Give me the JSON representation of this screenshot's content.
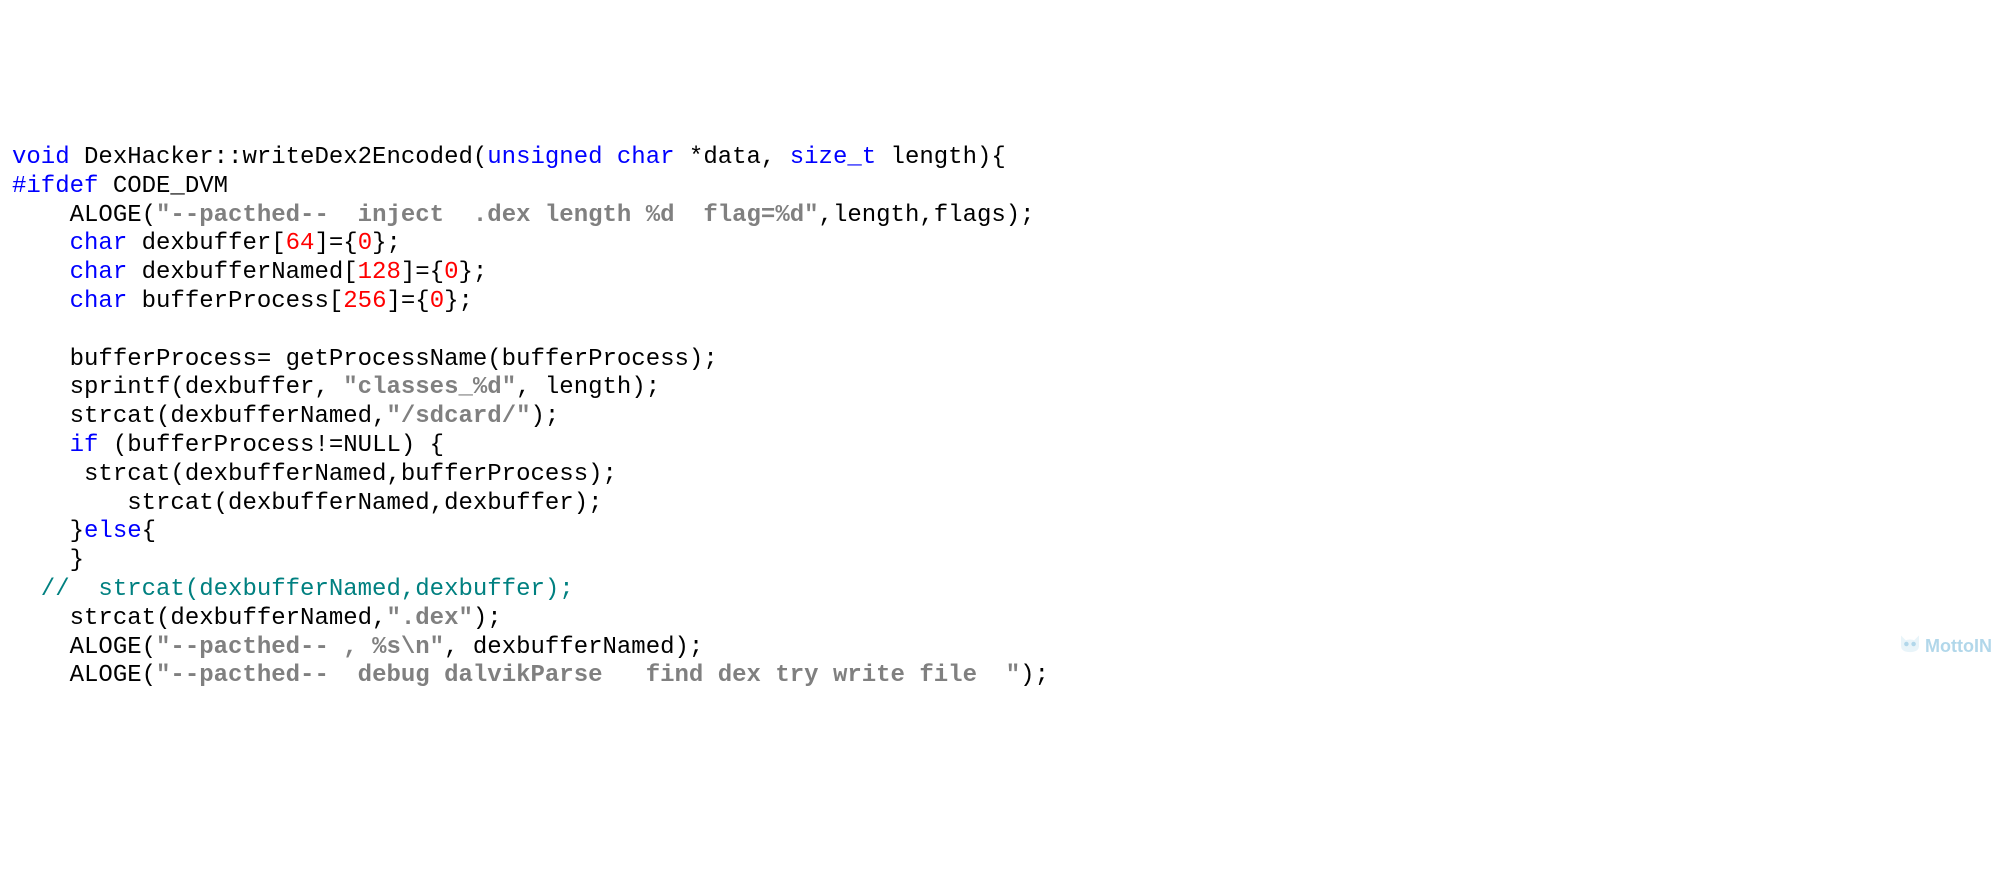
{
  "code": {
    "l1": {
      "kw_void": "void",
      "class_method": " DexHacker::writeDex2Encoded(",
      "kw_unsigned": "unsigned",
      "kw_char": " char",
      "rest1": " *data, ",
      "kw_sizet": "size_t",
      "rest2": " length){"
    },
    "l2": {
      "preproc": "#ifdef",
      "macro": " CODE_DVM"
    },
    "l3": {
      "pre": "    ALOGE(",
      "str": "\"--pacthed--  inject  .dex length %d  flag=%d\"",
      "post": ",length,flags);"
    },
    "l4": {
      "pad": "    ",
      "kw_char": "char",
      "rest1": " dexbuffer[",
      "num1": "64",
      "rest2": "]={",
      "num2": "0",
      "rest3": "};"
    },
    "l5": {
      "pad": "    ",
      "kw_char": "char",
      "rest1": " dexbufferNamed[",
      "num1": "128",
      "rest2": "]={",
      "num2": "0",
      "rest3": "};"
    },
    "l6": {
      "pad": "    ",
      "kw_char": "char",
      "rest1": " bufferProcess[",
      "num1": "256",
      "rest2": "]={",
      "num2": "0",
      "rest3": "};"
    },
    "l7": "",
    "l8": "    bufferProcess= getProcessName(bufferProcess);",
    "l9": {
      "pre": "    sprintf(dexbuffer, ",
      "str": "\"classes_%d\"",
      "post": ", length);"
    },
    "l10": {
      "pre": "    strcat(dexbufferNamed,",
      "str": "\"/sdcard/\"",
      "post": ");"
    },
    "l11": {
      "pad": "    ",
      "kw_if": "if",
      "rest": " (bufferProcess!=NULL) {"
    },
    "l12": "     strcat(dexbufferNamed,bufferProcess);",
    "l13": "        strcat(dexbufferNamed,dexbuffer);",
    "l14": {
      "pad": "    }",
      "kw_else": "else",
      "rest": "{"
    },
    "l15": "    }",
    "l16": {
      "comment": "  //  strcat(dexbufferNamed,dexbuffer);"
    },
    "l17": {
      "pre": "    strcat(dexbufferNamed,",
      "str": "\".dex\"",
      "post": ");"
    },
    "l18": {
      "pre": "    ALOGE(",
      "str": "\"--pacthed-- , %s\\n\"",
      "post": ", dexbufferNamed);"
    },
    "l19": {
      "pre": "    ALOGE(",
      "str": "\"--pacthed--  debug dalvikParse   find dex try write file  \"",
      "post": ");"
    }
  },
  "gutter": {
    "open": "",
    "close": ""
  },
  "watermark": {
    "text": "MottoIN"
  }
}
